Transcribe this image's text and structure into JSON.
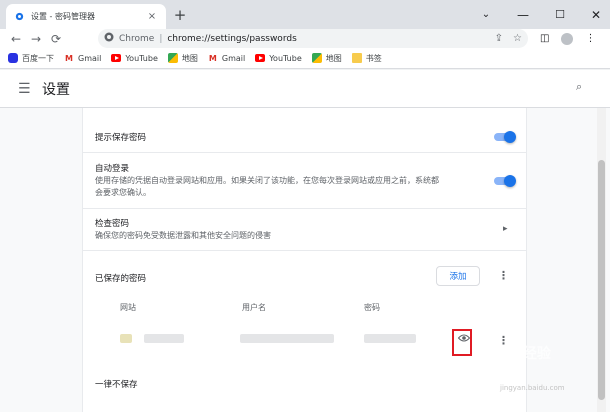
{
  "tab": {
    "title": "设置 - 密码管理器",
    "close": "×"
  },
  "newtab": "+",
  "window_controls": {
    "chevron": "⌄",
    "minimize": "—",
    "maximize": "☐",
    "close": "✕"
  },
  "nav": {
    "back": "←",
    "forward": "→",
    "reload": "⟳"
  },
  "omnibox": {
    "scheme": "Chrome",
    "separator": "|",
    "path": "chrome://settings/passwords"
  },
  "bookmarks": [
    {
      "label": "百度一下",
      "icon": "baidu-icon"
    },
    {
      "label": "Gmail",
      "icon": "gmail-icon"
    },
    {
      "label": "YouTube",
      "icon": "youtube-icon"
    },
    {
      "label": "地图",
      "icon": "maps-icon"
    },
    {
      "label": "Gmail",
      "icon": "gmail-icon"
    },
    {
      "label": "YouTube",
      "icon": "youtube-icon"
    },
    {
      "label": "地图",
      "icon": "maps-icon"
    },
    {
      "label": "书签",
      "icon": "folder-icon"
    }
  ],
  "settings": {
    "title": "设置"
  },
  "rows": {
    "offer_save": {
      "label": "提示保存密码",
      "enabled": true
    },
    "auto_signin": {
      "label": "自动登录",
      "sub": "使用存储的凭据自动登录网站和应用。如果关闭了该功能，在您每次登录网站或应用之前，系统都会要求您确认。",
      "enabled": true
    },
    "check_passwords": {
      "label": "检查密码",
      "sub": "确保您的密码免受数据泄露和其他安全问题的侵害"
    }
  },
  "saved": {
    "title": "已保存的密码",
    "add_label": "添加",
    "columns": [
      "网站",
      "用户名",
      "密码"
    ]
  },
  "never_saved": {
    "title": "一律不保存"
  },
  "watermark": "Baidu经验",
  "watermark_sub": "jingyan.baidu.com",
  "colors": {
    "accent": "#1a73e8",
    "highlight_box": "#e01b24"
  }
}
